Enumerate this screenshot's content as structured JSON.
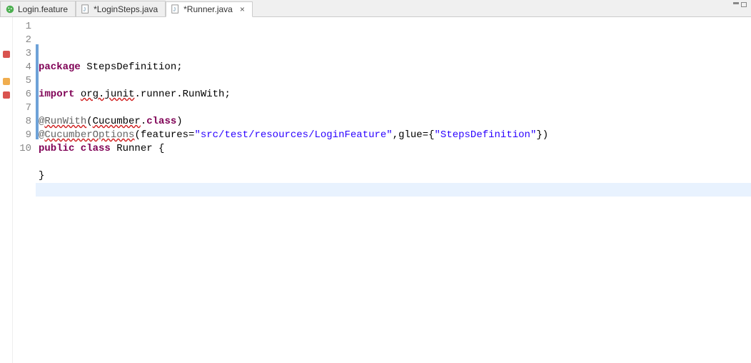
{
  "tabs": [
    {
      "label": "Login.feature",
      "active": false,
      "dirty": false,
      "iconType": "cucumber"
    },
    {
      "label": "*LoginSteps.java",
      "active": false,
      "dirty": true,
      "iconType": "java"
    },
    {
      "label": "*Runner.java",
      "active": true,
      "dirty": true,
      "iconType": "java"
    }
  ],
  "code": {
    "lines": [
      {
        "n": 1,
        "marker": "",
        "band": "plain",
        "segs": [
          {
            "t": "package ",
            "c": "kw"
          },
          {
            "t": "StepsDefinition;",
            "c": "cls"
          }
        ]
      },
      {
        "n": 2,
        "marker": "",
        "band": "plain",
        "segs": [
          {
            "t": "",
            "c": ""
          }
        ]
      },
      {
        "n": 3,
        "marker": "err",
        "band": "blue",
        "segs": [
          {
            "t": "import ",
            "c": "kw"
          },
          {
            "t": "org.junit",
            "c": "err-underline"
          },
          {
            "t": ".runner.RunWith;",
            "c": "cls"
          }
        ]
      },
      {
        "n": 4,
        "marker": "",
        "band": "blue",
        "segs": [
          {
            "t": "",
            "c": ""
          }
        ]
      },
      {
        "n": 5,
        "marker": "warn",
        "band": "blue",
        "segs": [
          {
            "t": "@",
            "c": "ann"
          },
          {
            "t": "RunWith",
            "c": "ann err-underline"
          },
          {
            "t": "(",
            "c": "cls"
          },
          {
            "t": "Cucumber",
            "c": "err-underline"
          },
          {
            "t": ".",
            "c": "cls"
          },
          {
            "t": "class",
            "c": "kw"
          },
          {
            "t": ")",
            "c": "cls"
          }
        ]
      },
      {
        "n": 6,
        "marker": "err",
        "band": "blue",
        "segs": [
          {
            "t": "@",
            "c": "ann"
          },
          {
            "t": "CucumberOptions",
            "c": "ann err-underline"
          },
          {
            "t": "(features=",
            "c": "cls"
          },
          {
            "t": "\"src/test/resources/LoginFeature\"",
            "c": "str"
          },
          {
            "t": ",glue={",
            "c": "cls"
          },
          {
            "t": "\"StepsDefinition\"",
            "c": "str"
          },
          {
            "t": "})",
            "c": "cls"
          }
        ]
      },
      {
        "n": 7,
        "marker": "",
        "band": "blue",
        "segs": [
          {
            "t": "public class ",
            "c": "kw"
          },
          {
            "t": "Runner {",
            "c": "cls"
          }
        ]
      },
      {
        "n": 8,
        "marker": "",
        "band": "blue",
        "segs": [
          {
            "t": "",
            "c": ""
          }
        ]
      },
      {
        "n": 9,
        "marker": "",
        "band": "blue",
        "segs": [
          {
            "t": "}",
            "c": "cls"
          }
        ]
      },
      {
        "n": 10,
        "marker": "",
        "band": "plain",
        "hl": true,
        "segs": [
          {
            "t": "",
            "c": ""
          }
        ]
      }
    ]
  }
}
